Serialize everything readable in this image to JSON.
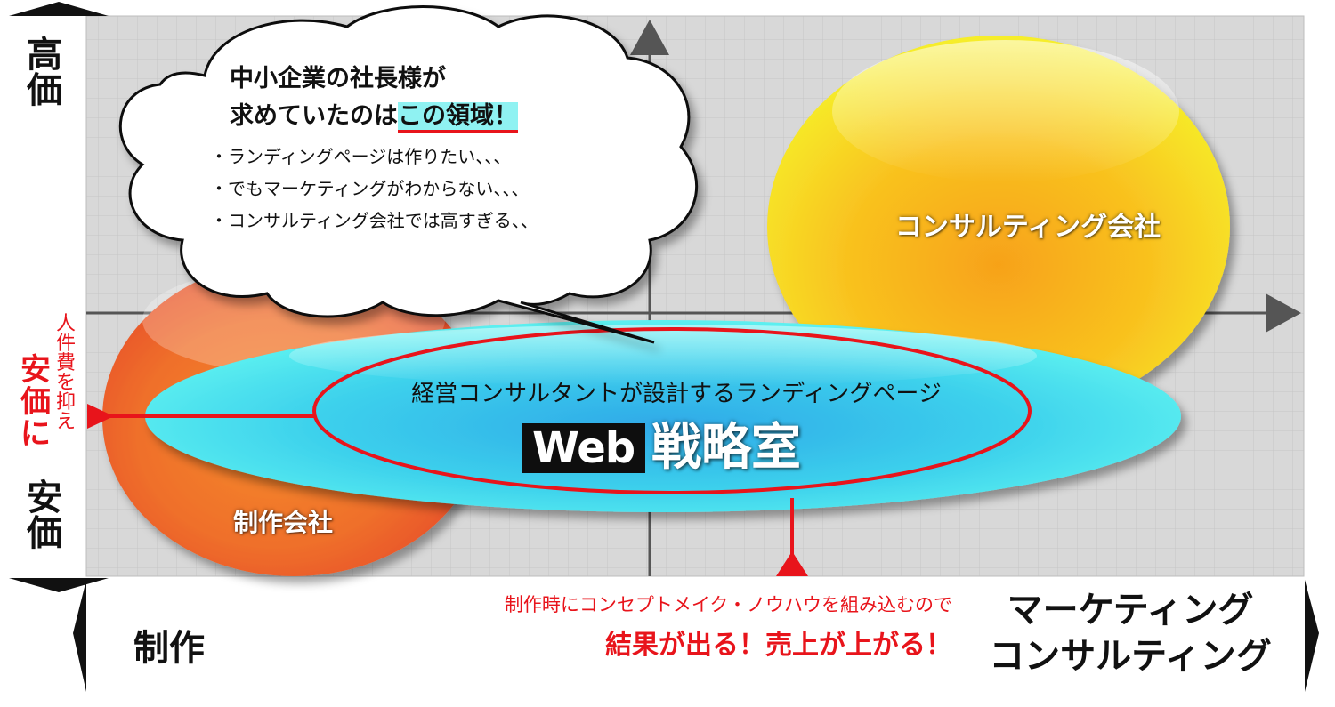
{
  "axis": {
    "y_high": "高価",
    "y_low": "安価",
    "x_left": "制作",
    "x_right_line1": "マーケティング",
    "x_right_line2": "コンサルティング"
  },
  "left_note": {
    "small": "人件費を抑え",
    "big": "安価に"
  },
  "cloud": {
    "title_line1": "中小企業の社長様が",
    "title_line2_prefix": "求めていたのは",
    "title_line2_highlight": "この領域！",
    "bullets": [
      "・ランディングページは作りたい、、、",
      "・でもマーケティングがわからない、、、",
      "・コンサルティング会社では高すぎる、、"
    ]
  },
  "bubbles": {
    "consulting": "コンサルティング会社",
    "production": "制作会社"
  },
  "web": {
    "subtitle": "経営コンサルタントが設計するランディングページ",
    "box": "Web",
    "kanji": "戦略室"
  },
  "bottom_note": {
    "small": "制作時にコンセプトメイク・ノウハウを組み込むので",
    "big": "結果が出る！売上が上がる！"
  },
  "colors": {
    "accent_red": "#e8141b",
    "highlight_cyan": "#8ff2f2",
    "plot_gray": "#d6d6d6",
    "consulting_yellow": "#f5e61c",
    "production_orange": "#f07a2a",
    "web_cyan": "#39d6e8"
  }
}
